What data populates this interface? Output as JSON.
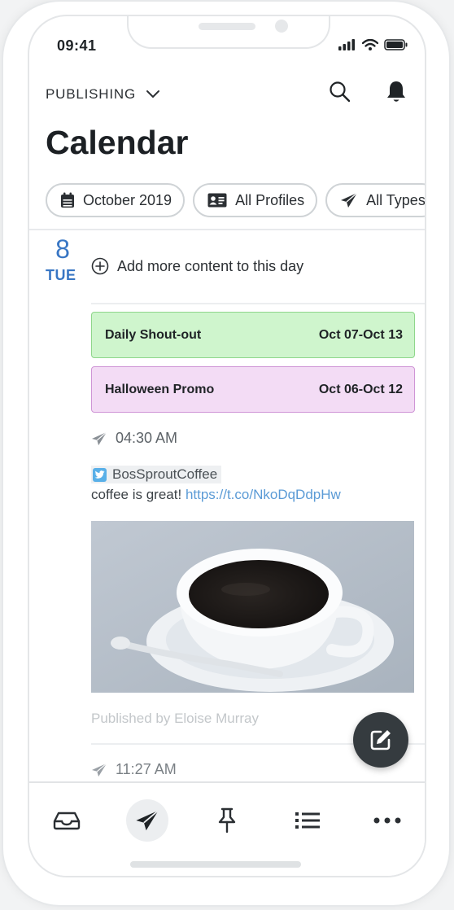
{
  "status_bar": {
    "time": "09:41"
  },
  "header": {
    "section_label": "PUBLISHING",
    "title": "Calendar"
  },
  "filters": {
    "date_label": "October 2019",
    "profiles_label": "All Profiles",
    "types_label": "All Types"
  },
  "day": {
    "number": "8",
    "weekday": "TUE",
    "add_content_label": "Add more content to this day"
  },
  "campaigns": [
    {
      "name": "Daily Shout-out",
      "range": "Oct 07-Oct 13",
      "color": "#cff5cd"
    },
    {
      "name": "Halloween Promo",
      "range": "Oct 06-Oct 12",
      "color": "#f3dcf5"
    }
  ],
  "posts": [
    {
      "time": "04:30 AM",
      "network": "twitter-icon",
      "profile": "BosSproutCoffee",
      "text": "coffee is great!",
      "link": "https://t.co/NkoDqDdpHw",
      "image": "coffee-cup-photo",
      "published_by": "Published by Eloise Murray"
    },
    {
      "time": "11:27 AM"
    }
  ],
  "colors": {
    "accent": "#3876c4",
    "link": "#5b9bd6",
    "fab": "#353b3f"
  }
}
